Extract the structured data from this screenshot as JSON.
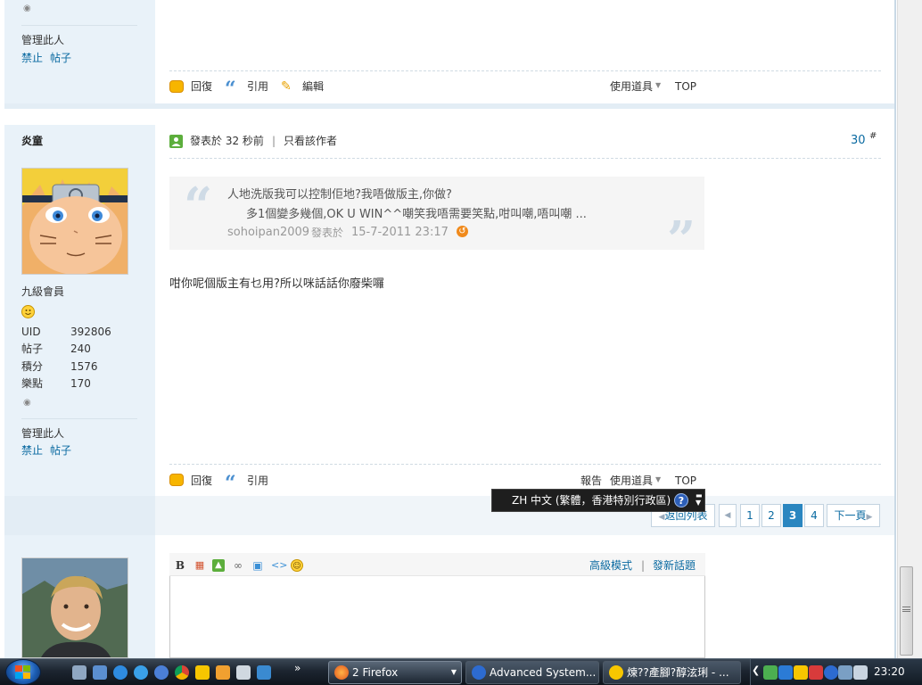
{
  "post_top": {
    "sidebar": {
      "manage_label": "管理此人",
      "ban_link": "禁止",
      "posts_link": "帖子"
    },
    "actions": {
      "reply": "回復",
      "quote": "引用",
      "edit": "編輯",
      "tools": "使用道具",
      "top": "TOP"
    }
  },
  "post_30": {
    "author": "炎童",
    "rank": "九級會員",
    "stats": [
      {
        "label": "UID",
        "value": "392806"
      },
      {
        "label": "帖子",
        "value": "240"
      },
      {
        "label": "積分",
        "value": "1576"
      },
      {
        "label": "樂點",
        "value": "170"
      }
    ],
    "manage_label": "管理此人",
    "ban_link": "禁止",
    "posts_link": "帖子",
    "posted_time": "發表於 32 秒前",
    "divider": "|",
    "only_author": "只看該作者",
    "floor_number": "30",
    "floor_mark": "#",
    "quote": {
      "line1": "人地洗版我可以控制佢地?我唔做版主,你做?",
      "line2": "多1個變多幾個,OK U WIN^^嘲笑我唔需要笑點,咁叫嘲,唔叫嘲 ...",
      "author": "sohoipan2009",
      "posted_on": "發表於",
      "date": "15-7-2011 23:17"
    },
    "message": "咁你呢個版主有乜用?所以咪話話你廢柴囉",
    "actions": {
      "reply": "回復",
      "quote": "引用",
      "report": "報告",
      "tools": "使用道具",
      "top": "TOP"
    }
  },
  "pager": {
    "back": "返回列表",
    "pages": [
      "1",
      "2",
      "3",
      "4"
    ],
    "current": "3",
    "next": "下一頁"
  },
  "ime": {
    "label": "ZH 中文 (繁體，香港特別行政區)",
    "help": "?"
  },
  "reply_editor": {
    "bold": "B",
    "advanced_mode": "高級模式",
    "separator": "|",
    "new_topic": "發新話題"
  },
  "taskbar": {
    "tasks": [
      {
        "label": "2 Firefox"
      },
      {
        "label": "Advanced System..."
      },
      {
        "label": "煉??產腳?醇泫琍 - ..."
      }
    ],
    "more": "»",
    "clock": "23:20"
  },
  "colors": {
    "link": "#0a6aa1",
    "sidebar": "#e9f2f9",
    "pager_current": "#2a86c0",
    "taskbar": "#1c2530"
  }
}
